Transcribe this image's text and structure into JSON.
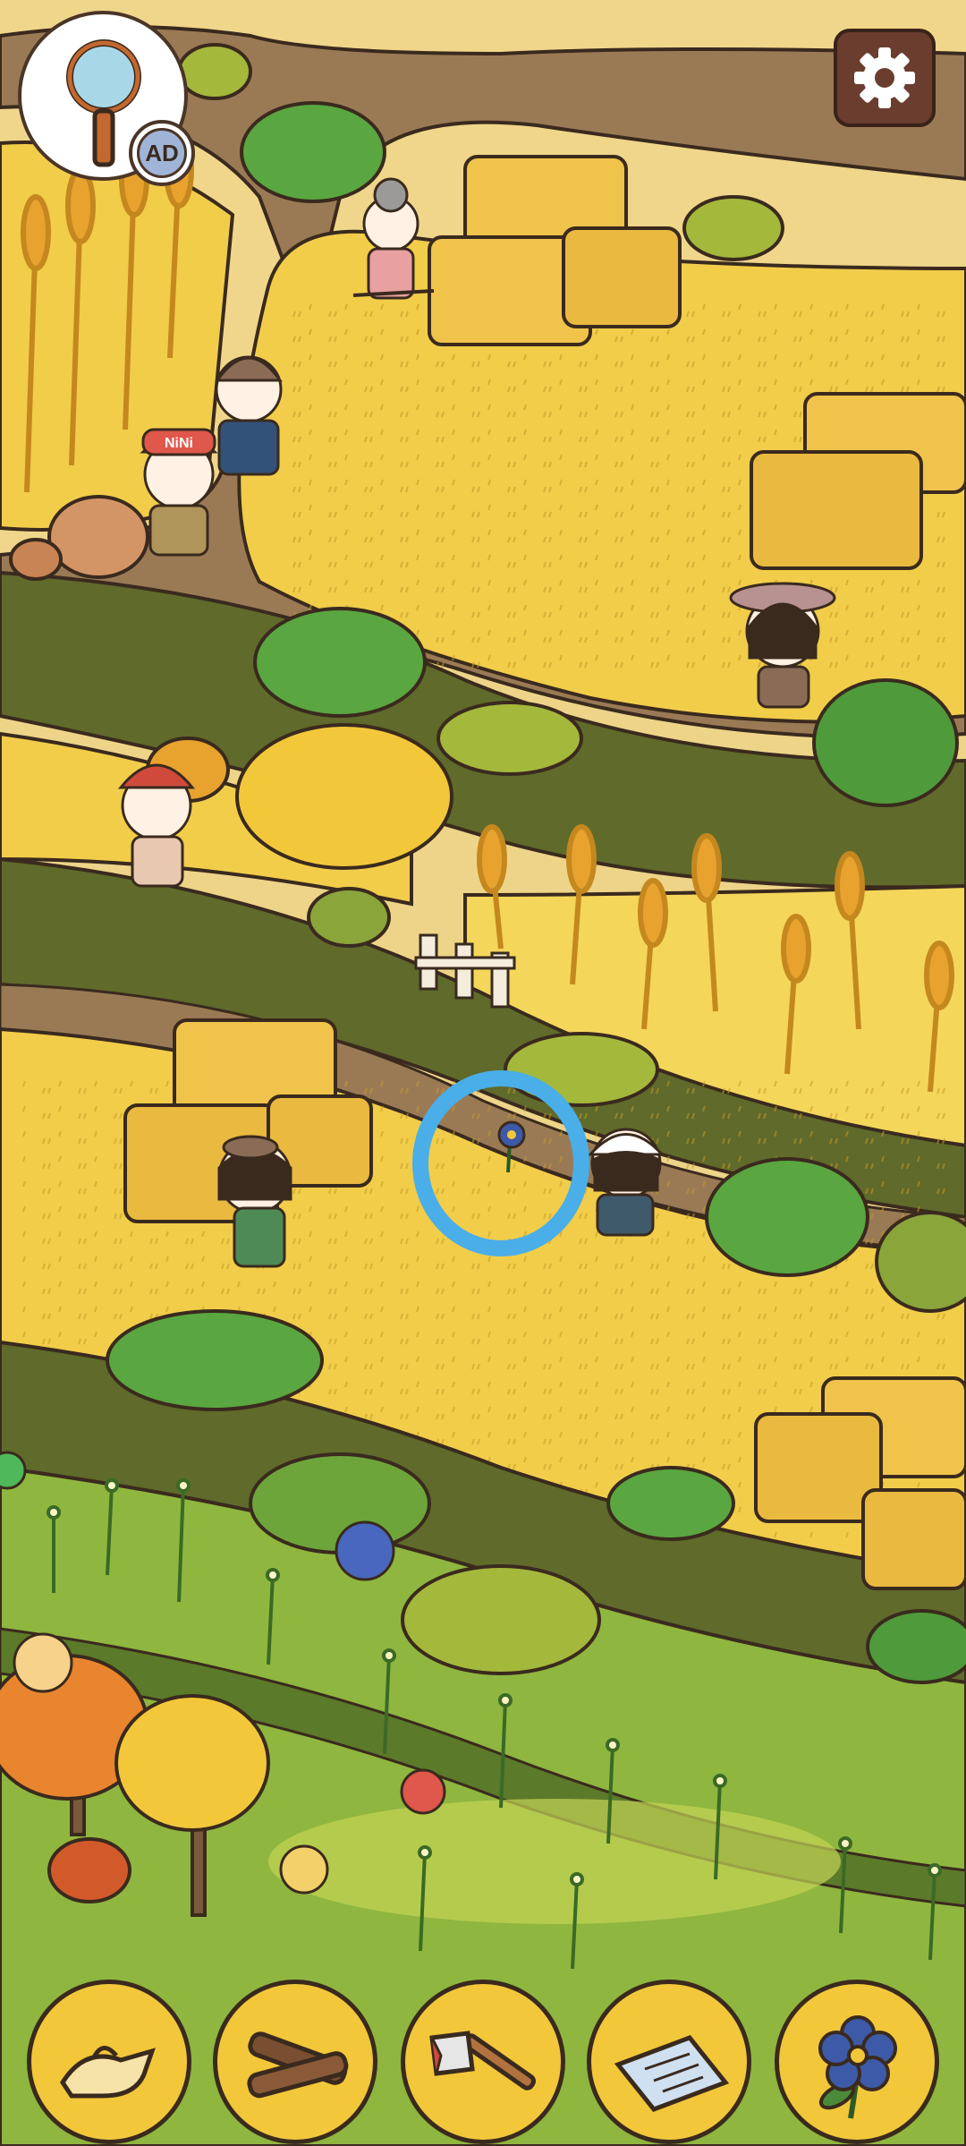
{
  "hud": {
    "hint_button": {
      "icon": "magnifier-icon",
      "badge_text": "AD"
    },
    "settings_button": {
      "icon": "gear-icon"
    }
  },
  "scene": {
    "cap_text": "NiNi",
    "found_marker": {
      "target": "blue-flower",
      "color": "#4aaee8"
    },
    "bubbles": [
      {
        "name": "green-bubble",
        "color": "#4fb85a"
      },
      {
        "name": "blue-bubble",
        "color": "#4a67c0"
      },
      {
        "name": "pale-orange-bubble",
        "color": "#f6d28a"
      },
      {
        "name": "red-bubble",
        "color": "#e0574b"
      },
      {
        "name": "yellow-bubble",
        "color": "#f4d06a"
      }
    ]
  },
  "items_tray": [
    {
      "name": "oil-lamp",
      "icon": "oil-lamp-icon",
      "found": false
    },
    {
      "name": "firewood",
      "icon": "firewood-icon",
      "found": false
    },
    {
      "name": "axe",
      "icon": "axe-icon",
      "found": false
    },
    {
      "name": "newspaper",
      "icon": "newspaper-icon",
      "found": false
    },
    {
      "name": "blue-flower",
      "icon": "flower-icon",
      "found": true
    }
  ],
  "colors": {
    "field_yellow": "#f1cd4a",
    "path_brown": "#9a7a55",
    "hedge_green": "#5f6a2b",
    "bush_green": "#5aa640",
    "outline": "#3a2a1e",
    "tray_gold": "#f2c73a"
  }
}
